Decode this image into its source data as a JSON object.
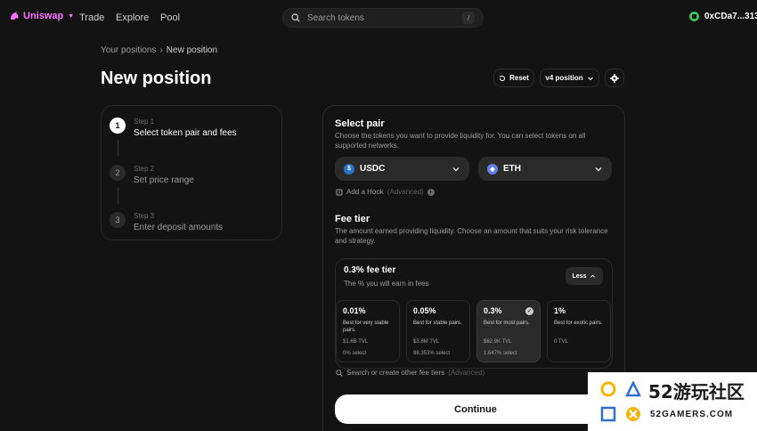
{
  "nav": {
    "brand": "Uniswap",
    "links": [
      "Trade",
      "Explore",
      "Pool"
    ],
    "search_placeholder": "Search tokens",
    "search_shortcut": "/",
    "account": "0xCDa7...3130",
    "brand_color": "#fc72ff"
  },
  "breadcrumb": {
    "parent": "Your positions",
    "sep": "›",
    "current": "New position"
  },
  "page_title": "New position",
  "toolbar": {
    "reset_label": "Reset",
    "version_label": "v4 position"
  },
  "steps": [
    {
      "num": "1",
      "label": "Step 1",
      "title": "Select token pair and fees"
    },
    {
      "num": "2",
      "label": "Step 2",
      "title": "Set price range"
    },
    {
      "num": "3",
      "label": "Step 3",
      "title": "Enter deposit amounts"
    }
  ],
  "select_pair": {
    "heading": "Select pair",
    "description": "Choose the tokens you want to provide liquidity for. You can select tokens on all supported networks.",
    "token_a": "USDC",
    "token_b": "ETH",
    "hook_label": "Add a Hook",
    "hook_adv": "(Advanced)"
  },
  "fee_tier": {
    "heading": "Fee tier",
    "description": "The amount earned providing liquidity. Choose an amount that suits your risk tolerance and strategy.",
    "current": "0.3% fee tier",
    "current_sub": "The % you will earn in fees",
    "less_label": "Less",
    "tiers": [
      {
        "pct": "0.01%",
        "desc": "Best for very stable pairs.",
        "tvl": "$1.6B TVL",
        "select": "0% select"
      },
      {
        "pct": "0.05%",
        "desc": "Best for stable pairs.",
        "tvl": "$3.8M TVL",
        "select": "98.353% select"
      },
      {
        "pct": "0.3%",
        "desc": "Best for most pairs.",
        "tvl": "$62.9K TVL",
        "select": "1.647% select"
      },
      {
        "pct": "1%",
        "desc": "Best for exotic pairs.",
        "tvl": "0 TVL",
        "select": ""
      }
    ],
    "search_label": "Search or create other fee tiers",
    "search_adv": "(Advanced)"
  },
  "continue_label": "Continue",
  "watermark": {
    "big": "52游玩社区",
    "small": "52GAMERS.COM"
  }
}
